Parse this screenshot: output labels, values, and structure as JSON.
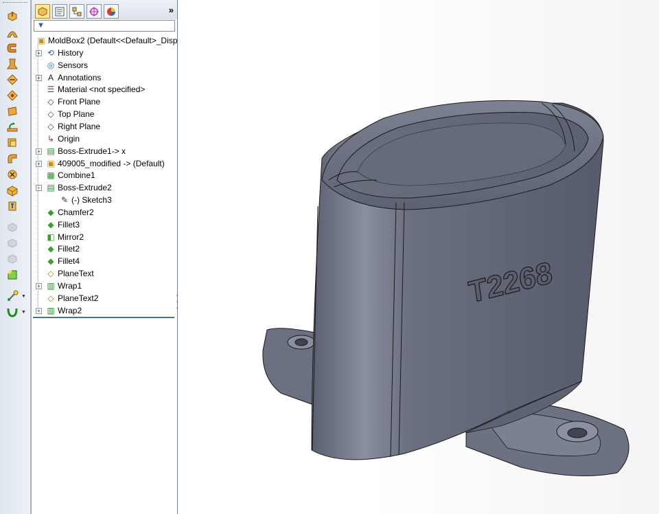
{
  "toolbar": {
    "icons": [
      "extrude-icon",
      "revolve-icon",
      "sweep-icon",
      "loft-icon",
      "rib-icon",
      "draft-icon",
      "plane-icon",
      "boundary-icon",
      "shell-icon",
      "dome-icon",
      "combine-icon",
      "hole-icon",
      "wrap-icon",
      "mirror-icon",
      "pattern-icon",
      "feature-icon",
      "curves-icon",
      "reference-icon"
    ]
  },
  "feature_manager": {
    "tabs": [
      "featuremanager-tab",
      "propertymanager-tab",
      "configurationmanager-tab",
      "dimxpert-tab",
      "display-manager-tab"
    ],
    "more": "»",
    "tree": [
      {
        "label": "MoldBox2  (Default<<Default>_Disp",
        "icon": "part-icon",
        "level": 0,
        "expander": ""
      },
      {
        "label": "History",
        "icon": "history-icon",
        "level": 1,
        "expander": "+"
      },
      {
        "label": "Sensors",
        "icon": "sensors-icon",
        "level": 1,
        "expander": ""
      },
      {
        "label": "Annotations",
        "icon": "annotations-icon",
        "level": 1,
        "expander": "+"
      },
      {
        "label": "Material <not specified>",
        "icon": "material-icon",
        "level": 1,
        "expander": ""
      },
      {
        "label": "Front Plane",
        "icon": "plane-icon",
        "level": 1,
        "expander": ""
      },
      {
        "label": "Top Plane",
        "icon": "plane-icon",
        "level": 1,
        "expander": ""
      },
      {
        "label": "Right Plane",
        "icon": "plane-icon",
        "level": 1,
        "expander": ""
      },
      {
        "label": "Origin",
        "icon": "origin-icon",
        "level": 1,
        "expander": ""
      },
      {
        "label": "Boss-Extrude1-> x",
        "icon": "boss-extrude-icon",
        "level": 1,
        "expander": "+"
      },
      {
        "label": "409005_modified -> (Default)",
        "icon": "part-icon",
        "level": 1,
        "expander": "+"
      },
      {
        "label": "Combine1",
        "icon": "combine-icon",
        "level": 1,
        "expander": ""
      },
      {
        "label": "Boss-Extrude2",
        "icon": "boss-extrude-icon",
        "level": 1,
        "expander": "−"
      },
      {
        "label": "(-) Sketch3",
        "icon": "sketch-icon",
        "level": 2,
        "expander": ""
      },
      {
        "label": "Chamfer2",
        "icon": "chamfer-icon",
        "level": 1,
        "expander": ""
      },
      {
        "label": "Fillet3",
        "icon": "fillet-icon",
        "level": 1,
        "expander": ""
      },
      {
        "label": "Mirror2",
        "icon": "mirror-icon",
        "level": 1,
        "expander": ""
      },
      {
        "label": "Fillet2",
        "icon": "fillet-icon",
        "level": 1,
        "expander": ""
      },
      {
        "label": "Fillet4",
        "icon": "fillet-icon",
        "level": 1,
        "expander": ""
      },
      {
        "label": "PlaneText",
        "icon": "planetext-icon",
        "level": 1,
        "expander": ""
      },
      {
        "label": "Wrap1",
        "icon": "wrap-icon",
        "level": 1,
        "expander": "+"
      },
      {
        "label": "PlaneText2",
        "icon": "planetext-icon",
        "level": 1,
        "expander": ""
      },
      {
        "label": "Wrap2",
        "icon": "wrap-icon",
        "level": 1,
        "expander": "+"
      }
    ]
  },
  "viewport": {
    "model_text": "T2268",
    "model_color": "#5d6272",
    "background": "#ffffff"
  }
}
